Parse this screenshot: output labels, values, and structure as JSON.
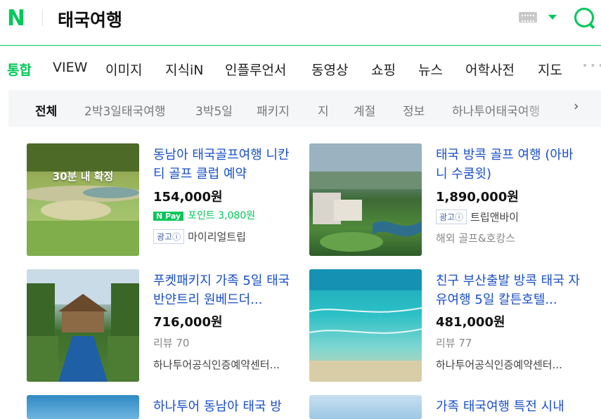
{
  "header": {
    "logo_text": "N",
    "query": "태국여행",
    "icons": [
      "keyboard-icon",
      "caret-down-icon",
      "search-icon"
    ],
    "accent_color": "#03c75a"
  },
  "tabs": [
    "통합",
    "VIEW",
    "이미지",
    "지식iN",
    "인플루언서",
    "동영상",
    "쇼핑",
    "뉴스",
    "어학사전",
    "지도"
  ],
  "active_tab": "통합",
  "subfilters": [
    "전체",
    "2박3일태국여행",
    "3박5일",
    "패키지",
    "지",
    "계절",
    "정보",
    "하나투어태국여행"
  ],
  "active_subfilter": "전체",
  "cards": [
    {
      "title": "동남아 태국골프여행 니칸티 골프 클럽 예약",
      "price": "154,000원",
      "overlay": "30분 내 확정",
      "npay_label": "Pay",
      "npay_points": "포인트 3,080원",
      "ad_label": "광고ⓘ",
      "seller": "마이리얼트립"
    },
    {
      "title": "태국 방콕 골프 여행 (아바니 수쿰윗)",
      "price": "1,890,000원",
      "ad_label": "광고ⓘ",
      "seller": "트립앤바이",
      "category": "해외 골프&호캉스"
    },
    {
      "title": "푸켓패키지 가족 5일 태국 반얀트리 원베드더...",
      "price": "716,000원",
      "reviews": "리뷰 70",
      "seller": "하나투어공식인증예약센터..."
    },
    {
      "title": "친구 부산출발 방콕 태국 자유여행 5일 칼튼호텔...",
      "price": "481,000원",
      "reviews": "리뷰 77",
      "seller": "하나투어공식인증예약센터..."
    },
    {
      "title": "하나투어 동남아 태국 방"
    },
    {
      "title": "가족 태국여행 특전 시내"
    }
  ]
}
